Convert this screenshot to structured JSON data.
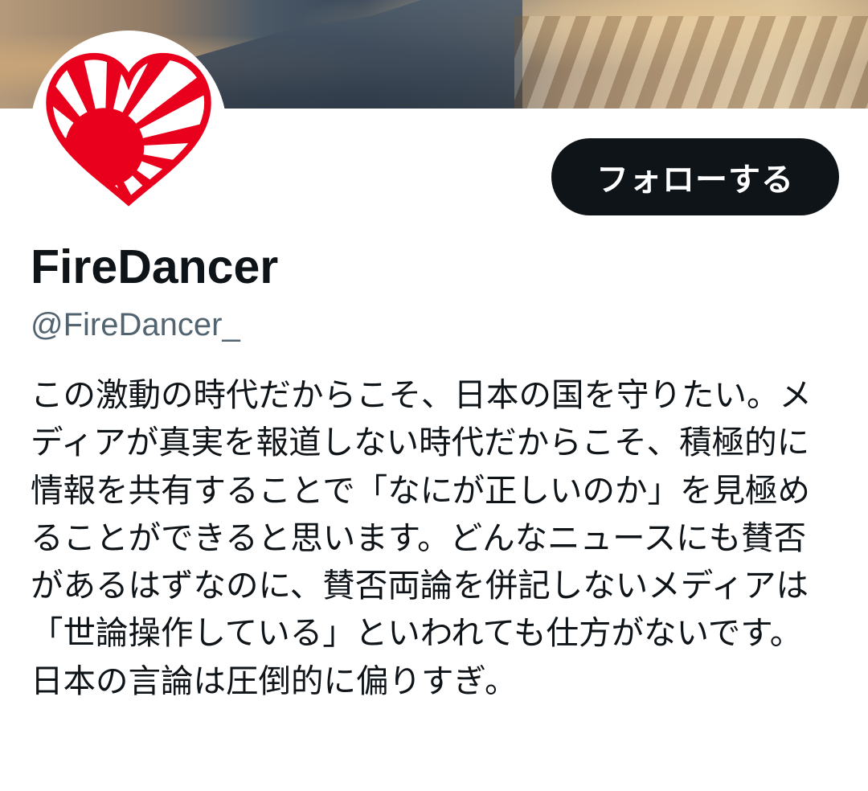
{
  "profile": {
    "display_name": "FireDancer",
    "handle": "@FireDancer_",
    "bio": "この激動の時代だからこそ、日本の国を守りたい。メディアが真実を報道しない時代だからこそ、積極的に情報を共有することで「なにが正しいのか」を見極めることができると思います。どんなニュースにも賛否があるはずなのに、賛否両論を併記しないメディアは「世論操作している」といわれても仕方がないです。日本の言論は圧倒的に偏りすぎ。"
  },
  "actions": {
    "follow_label": "フォローする"
  },
  "colors": {
    "follow_button_bg": "#0f1419",
    "handle_gray": "#536471",
    "heart_red": "#e8001c"
  },
  "icons": {
    "avatar": "rising-sun-heart-icon"
  }
}
